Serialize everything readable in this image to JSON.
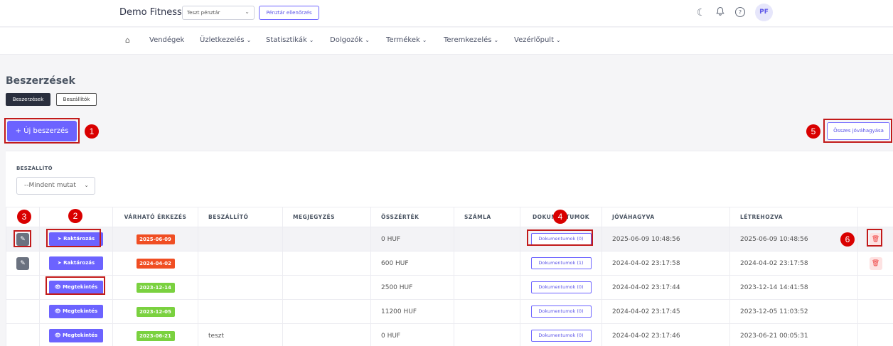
{
  "header": {
    "brand": "Demo Fitness",
    "kassza_select": "Teszt pénztár",
    "kassza_button": "Pénztár ellenőrzés",
    "avatar": "PF"
  },
  "nav": {
    "items": [
      {
        "label": "Vendégek",
        "dropdown": false
      },
      {
        "label": "Üzletkezelés",
        "dropdown": true
      },
      {
        "label": "Statisztikák",
        "dropdown": true
      },
      {
        "label": "Dolgozók",
        "dropdown": true
      },
      {
        "label": "Termékek",
        "dropdown": true
      },
      {
        "label": "Teremkezelés",
        "dropdown": true
      },
      {
        "label": "Vezérlőpult",
        "dropdown": true
      }
    ]
  },
  "page": {
    "title": "Beszerzések",
    "tabs": [
      "Beszerzések",
      "Beszállítók"
    ],
    "new_button": "Új beszerzés",
    "approve_all_button": "Összes jóváhagyása"
  },
  "filter": {
    "label": "BESZÁLLÍTÓ",
    "value": "--Mindent mutat"
  },
  "table": {
    "headers": [
      "",
      "",
      "VÁRHATÓ ÉRKEZÉS",
      "BESZÁLLÍTÓ",
      "MEGJEGYZÉS",
      "ÖSSZÉRTÉK",
      "SZÁMLA",
      "DOKUMENTUMOK",
      "JÓVÁHAGYVA",
      "LÉTREHOZVA",
      ""
    ],
    "rows": [
      {
        "editable": true,
        "action": "Raktározás",
        "arrival": "2025-06-09",
        "arrival_status": "red",
        "supplier": "",
        "note": "",
        "total": "0 HUF",
        "invoice": "",
        "documents": "Dokumentumok (0)",
        "approved": "2025-06-09 10:48:56",
        "created": "2025-06-09 10:48:56",
        "deletable": true
      },
      {
        "editable": true,
        "action": "Raktározás",
        "arrival": "2024-04-02",
        "arrival_status": "red",
        "supplier": "",
        "note": "",
        "total": "600 HUF",
        "invoice": "",
        "documents": "Dokumentumok (1)",
        "approved": "2024-04-02 23:17:58",
        "created": "2024-04-02 23:17:58",
        "deletable": true
      },
      {
        "editable": false,
        "action": "Megtekintés",
        "arrival": "2023-12-14",
        "arrival_status": "green",
        "supplier": "",
        "note": "",
        "total": "2500 HUF",
        "invoice": "",
        "documents": "Dokumentumok (0)",
        "approved": "2024-04-02 23:17:44",
        "created": "2023-12-14 14:41:58",
        "deletable": false
      },
      {
        "editable": false,
        "action": "Megtekintés",
        "arrival": "2023-12-05",
        "arrival_status": "green",
        "supplier": "",
        "note": "",
        "total": "11200 HUF",
        "invoice": "",
        "documents": "Dokumentumok (0)",
        "approved": "2024-04-02 23:17:45",
        "created": "2023-12-05 11:03:52",
        "deletable": false
      },
      {
        "editable": false,
        "action": "Megtekintés",
        "arrival": "2023-06-21",
        "arrival_status": "green",
        "supplier": "teszt",
        "note": "",
        "total": "0 HUF",
        "invoice": "",
        "documents": "Dokumentumok (0)",
        "approved": "2024-04-02 23:17:46",
        "created": "2023-06-21 00:05:31",
        "deletable": false
      }
    ]
  },
  "annotations": [
    "1",
    "2",
    "3",
    "4",
    "5",
    "6"
  ],
  "colors": {
    "accent": "#6c63ff",
    "annotation": "#d90000",
    "overdue": "#f04e23",
    "ok": "#7ad13f"
  }
}
